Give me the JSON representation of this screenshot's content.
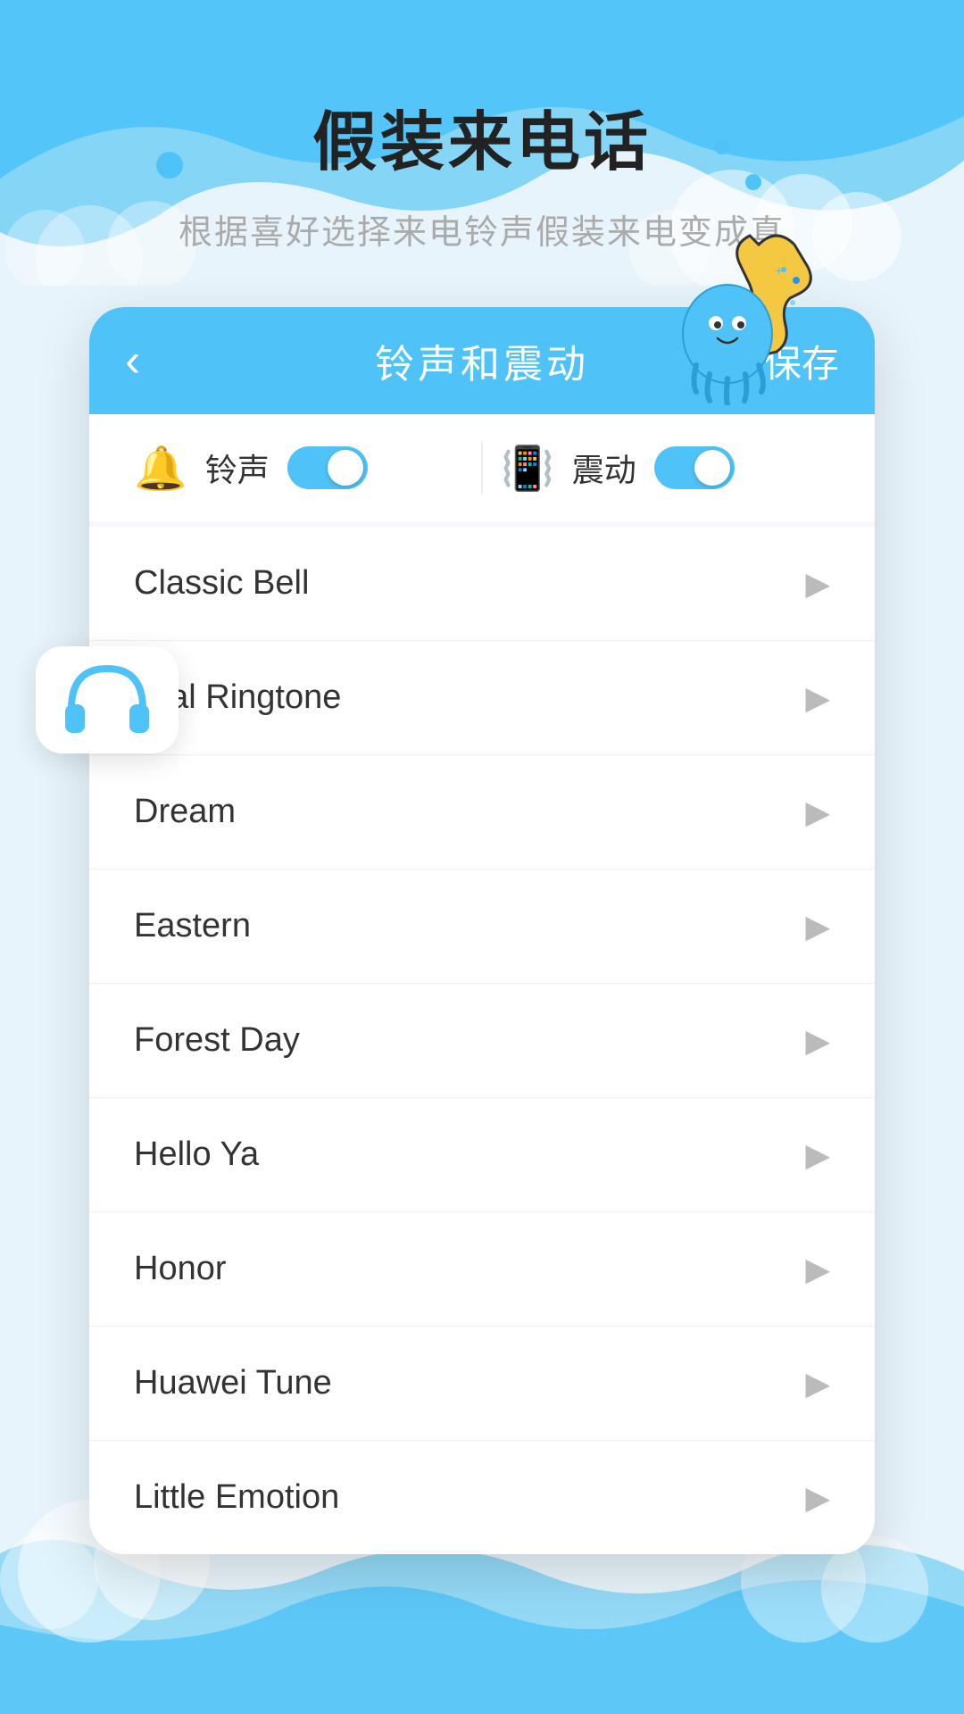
{
  "header": {
    "main_title": "假装来电话",
    "subtitle": "根据喜好选择来电铃声假装来电变成真"
  },
  "topbar": {
    "back_label": "‹",
    "title": "铃声和震动",
    "save_label": "保存"
  },
  "toggles": [
    {
      "icon": "🔔",
      "label": "铃声",
      "enabled": true
    },
    {
      "icon": "📳",
      "label": "震动",
      "enabled": true
    }
  ],
  "ringtones": [
    {
      "name": "Classic Bell"
    },
    {
      "name": "gital Ringtone"
    },
    {
      "name": "Dream"
    },
    {
      "name": "Eastern"
    },
    {
      "name": "Forest Day"
    },
    {
      "name": "Hello Ya"
    },
    {
      "name": "Honor"
    },
    {
      "name": "Huawei Tune"
    },
    {
      "name": "Little Emotion"
    }
  ],
  "colors": {
    "primary": "#4fc3f7",
    "background": "#e8f4fb",
    "text_dark": "#222",
    "text_gray": "#aaa"
  }
}
